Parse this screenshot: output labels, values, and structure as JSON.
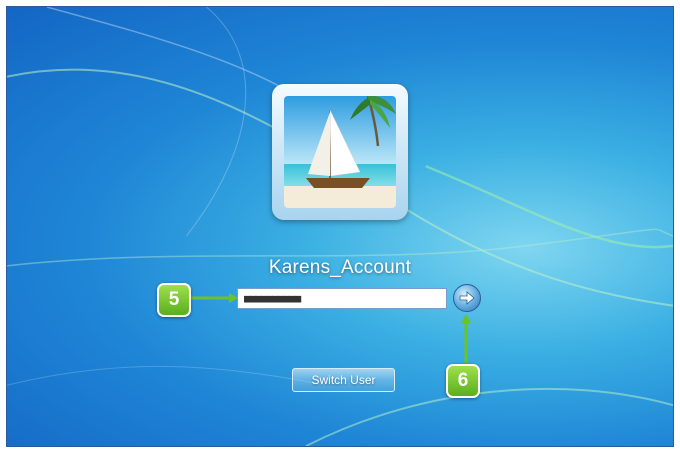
{
  "login": {
    "username": "Karens_Account",
    "password_masked": "■■■■■■■■■■",
    "switch_user_label": "Switch User"
  },
  "annotations": {
    "step_5": "5",
    "step_6": "6"
  },
  "colors": {
    "background": "#1f86d6",
    "annotation_green": "#5aae1f"
  },
  "icons": {
    "submit": "arrow-right-icon"
  }
}
